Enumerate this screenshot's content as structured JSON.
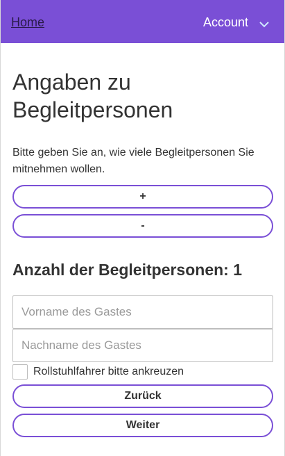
{
  "nav": {
    "home_label": "Home",
    "account_label": "Account",
    "accent_color": "#7a4fd6"
  },
  "page": {
    "title": "Angaben zu Begleitpersonen",
    "description": "Bitte geben Sie an, wie viele Begleitpersonen Sie mitnehmen wollen.",
    "plus_label": "+",
    "minus_label": "-",
    "count_heading": "Anzahl der Begleitpersonen: 1"
  },
  "form": {
    "first_name": {
      "value": "",
      "placeholder": "Vorname des Gastes"
    },
    "last_name": {
      "value": "",
      "placeholder": "Nachname des Gastes"
    },
    "wheelchair_label": "Rollstuhlfahrer bitte ankreuzen",
    "wheelchair_checked": false
  },
  "actions": {
    "back_label": "Zurück",
    "next_label": "Weiter"
  }
}
